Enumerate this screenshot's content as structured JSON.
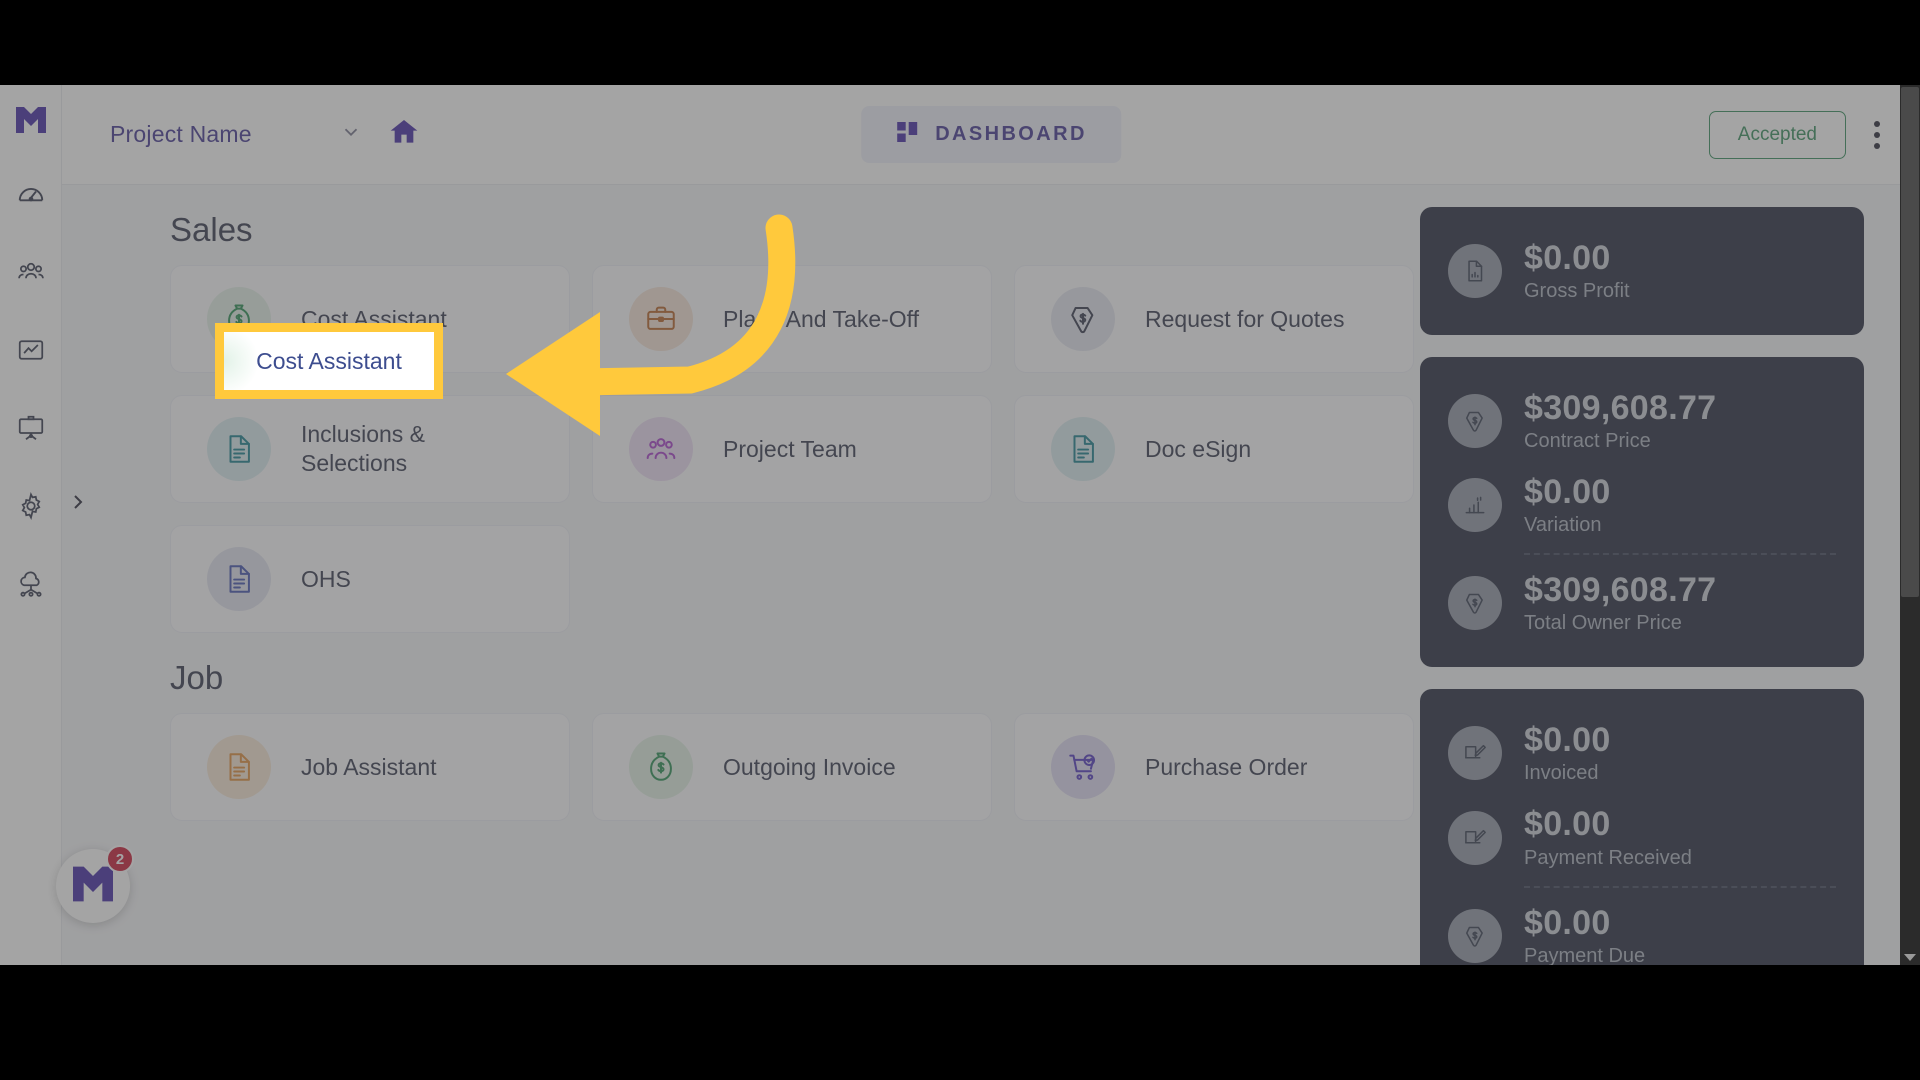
{
  "header": {
    "project_name": "Project Name",
    "caret_icon": "chevron-down-icon",
    "home_icon": "home-icon",
    "dashboard_label": "DASHBOARD",
    "dashboard_icon": "grid-icon",
    "status_label": "Accepted",
    "status_color": "#2e8b57",
    "kebab_icon": "more-vertical-icon"
  },
  "sidebar": {
    "logo": "m-logo-icon",
    "expand_icon": "chevron-right-icon",
    "items": [
      {
        "name": "dashboard",
        "icon": "speedometer-icon"
      },
      {
        "name": "team",
        "icon": "people-icon"
      },
      {
        "name": "reports",
        "icon": "chart-frame-icon"
      },
      {
        "name": "presentation",
        "icon": "presentation-board-icon"
      },
      {
        "name": "settings",
        "icon": "gear-icon"
      },
      {
        "name": "cloud",
        "icon": "cloud-network-icon"
      }
    ],
    "avatar": {
      "icon": "m-logo-icon",
      "badge": "2",
      "badge_color": "#c8102e"
    }
  },
  "main": {
    "sections": [
      {
        "title": "Sales",
        "rows": [
          [
            {
              "label": "Cost Assistant",
              "icon": "money-bag-icon",
              "icon_color": "#1f8a4c",
              "chip": "#e2f0e6"
            },
            {
              "label": "Plans And Take-Off",
              "icon": "briefcase-icon",
              "icon_color": "#b35c1e",
              "chip": "#f6e3d4"
            },
            {
              "label": "Request for Quotes",
              "icon": "price-tag-icon",
              "icon_color": "#2a2f45",
              "chip": "#e3e5f0"
            }
          ],
          [
            {
              "label": "Inclusions & Selections",
              "icon": "document-icon",
              "icon_color": "#0f7b8a",
              "chip": "#d8ecef"
            },
            {
              "label": "Project Team",
              "icon": "people-icon",
              "icon_color": "#a435c9",
              "chip": "#ecdbf4"
            },
            {
              "label": "Doc eSign",
              "icon": "document-icon",
              "icon_color": "#0f7b8a",
              "chip": "#d8ecef"
            }
          ],
          [
            {
              "label": "OHS",
              "icon": "document-icon",
              "icon_color": "#3b4cad",
              "chip": "#e1e3f0"
            }
          ]
        ]
      },
      {
        "title": "Job",
        "rows": [
          [
            {
              "label": "Job Assistant",
              "icon": "document-icon",
              "icon_color": "#e08a34",
              "chip": "#f8e6d2"
            },
            {
              "label": "Outgoing Invoice",
              "icon": "money-bag-icon",
              "icon_color": "#1f8a4c",
              "chip": "#dff0e3"
            },
            {
              "label": "Purchase Order",
              "icon": "cart-check-icon",
              "icon_color": "#4b2fbf",
              "chip": "#ddd9f3"
            }
          ]
        ]
      }
    ]
  },
  "kpi": {
    "groups": [
      {
        "rows": [
          {
            "value": "$0.00",
            "label": "Gross Profit",
            "icon": "document-chart-icon",
            "divider_after": false
          }
        ]
      },
      {
        "rows": [
          {
            "value": "$309,608.77",
            "label": "Contract Price",
            "icon": "price-tag-icon",
            "divider_after": false
          },
          {
            "value": "$0.00",
            "label": "Variation",
            "icon": "bar-chart-icon",
            "divider_after": true
          },
          {
            "value": "$309,608.77",
            "label": "Total Owner Price",
            "icon": "price-tag-icon",
            "divider_after": false
          }
        ]
      },
      {
        "rows": [
          {
            "value": "$0.00",
            "label": "Invoiced",
            "icon": "invoice-edit-icon",
            "divider_after": false
          },
          {
            "value": "$0.00",
            "label": "Payment Received",
            "icon": "invoice-edit-icon",
            "divider_after": true
          },
          {
            "value": "$0.00",
            "label": "Payment Due",
            "icon": "price-tag-icon",
            "divider_after": false
          }
        ]
      }
    ]
  },
  "annotation": {
    "highlight_label": "Cost Assistant",
    "highlight_color": "#ffc93c",
    "arrow_icon": "curved-arrow-left-icon"
  }
}
